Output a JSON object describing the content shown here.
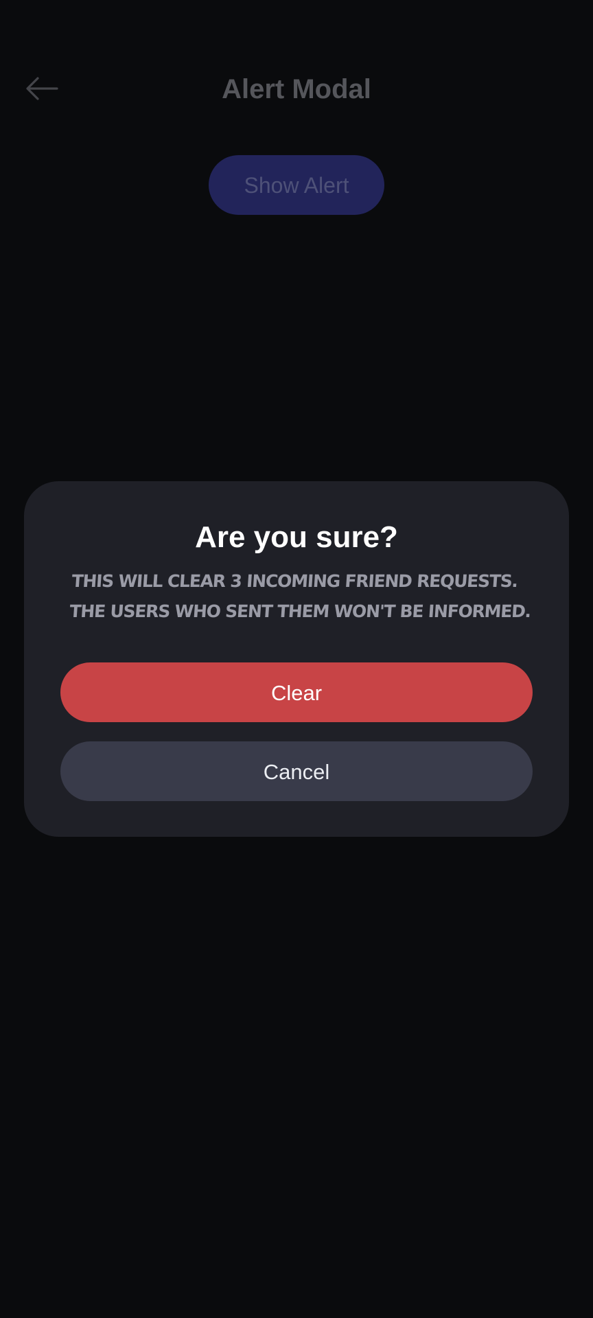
{
  "header": {
    "title": "Alert Modal",
    "back_icon": "arrow-left-icon"
  },
  "page": {
    "show_alert_label": "Show Alert"
  },
  "modal": {
    "title": "Are you sure?",
    "message_line1": "This will clear 3 incoming friend requests.",
    "message_line2": "The users who sent them won't be informed.",
    "clear_label": "Clear",
    "cancel_label": "Cancel"
  },
  "colors": {
    "background": "#0a0b0d",
    "modal_bg": "#1f2027",
    "destructive": "#c84446",
    "secondary": "#393b4a",
    "primary_dimmed": "#22245a"
  }
}
